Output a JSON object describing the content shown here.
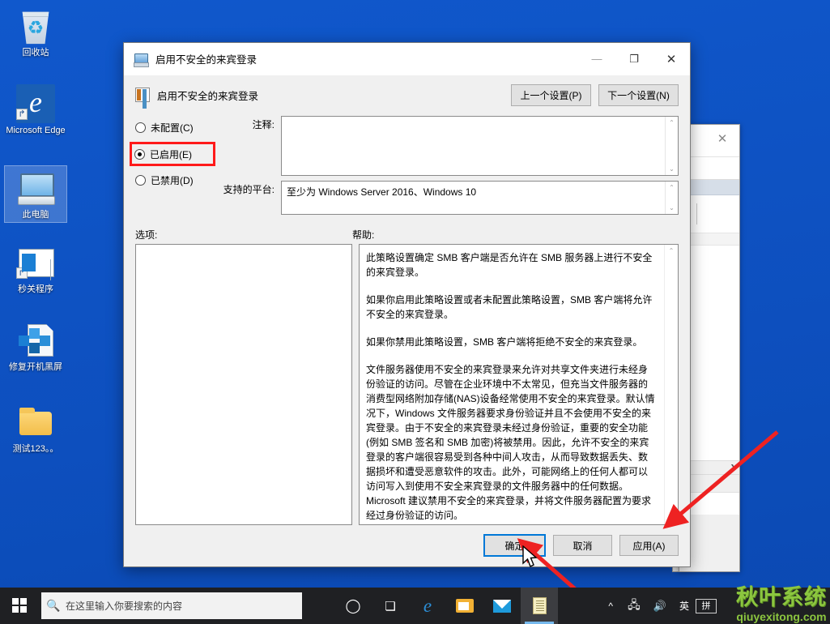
{
  "desktop": {
    "icons": [
      {
        "label": "回收站",
        "icon": "recycle-bin-icon",
        "selected": false,
        "shortcut": false
      },
      {
        "label": "Microsoft Edge",
        "icon": "microsoft-edge-icon",
        "selected": false,
        "shortcut": true
      },
      {
        "label": "此电脑",
        "icon": "this-pc-icon",
        "selected": true,
        "shortcut": false
      },
      {
        "label": "秒关程序",
        "icon": "program-window-icon",
        "selected": false,
        "shortcut": true
      },
      {
        "label": "修复开机黑屏",
        "icon": "file-cube-icon",
        "selected": false,
        "shortcut": false
      },
      {
        "label": "测试123。。",
        "icon": "folder-icon",
        "selected": false,
        "shortcut": false
      }
    ],
    "background_color": "#0f55c9"
  },
  "dialog": {
    "titlebar": {
      "icon": "policy-setting-icon",
      "title": "启用不安全的来宾登录",
      "minimize_label": "—",
      "maximize_label": "❐",
      "close_label": "✕"
    },
    "header": {
      "icon": "policy-list-icon",
      "title": "启用不安全的来宾登录",
      "prev_button": "上一个设置(P)",
      "next_button": "下一个设置(N)"
    },
    "radios": [
      {
        "label": "未配置(C)",
        "checked": false,
        "highlighted": false
      },
      {
        "label": "已启用(E)",
        "checked": true,
        "highlighted": true
      },
      {
        "label": "已禁用(D)",
        "checked": false,
        "highlighted": false
      }
    ],
    "comment": {
      "label": "注释:",
      "value": ""
    },
    "platform": {
      "label": "支持的平台:",
      "value": "至少为 Windows Server 2016、Windows 10"
    },
    "options": {
      "label": "选项:",
      "value": ""
    },
    "help": {
      "label": "帮助:",
      "paragraphs": [
        "此策略设置确定 SMB 客户端是否允许在 SMB 服务器上进行不安全的来宾登录。",
        "如果你启用此策略设置或者未配置此策略设置，SMB 客户端将允许不安全的来宾登录。",
        "如果你禁用此策略设置，SMB 客户端将拒绝不安全的来宾登录。",
        "文件服务器使用不安全的来宾登录来允许对共享文件夹进行未经身份验证的访问。尽管在企业环境中不太常见，但充当文件服务器的消费型网络附加存储(NAS)设备经常使用不安全的来宾登录。默认情况下，Windows 文件服务器要求身份验证并且不会使用不安全的来宾登录。由于不安全的来宾登录未经过身份验证，重要的安全功能(例如 SMB 签名和 SMB 加密)将被禁用。因此，允许不安全的来宾登录的客户端很容易受到各种中间人攻击，从而导致数据丢失、数据损坏和遭受恶意软件的攻击。此外，可能网络上的任何人都可以访问写入到使用不安全来宾登录的文件服务器中的任何数据。Microsoft 建议禁用不安全的来宾登录，并将文件服务器配置为要求经过身份验证的访问。"
      ]
    },
    "footer": {
      "ok": "确定",
      "cancel": "取消",
      "apply": "应用(A)"
    }
  },
  "taskbar": {
    "start_label": "start-button",
    "search_placeholder": "在这里输入你要搜索的内容",
    "apps": [
      {
        "name": "cortana-icon",
        "glyph": "◯",
        "active": false
      },
      {
        "name": "task-view-icon",
        "glyph": "❏",
        "active": false
      },
      {
        "name": "microsoft-edge-icon",
        "glyph": "e",
        "active": false
      },
      {
        "name": "file-explorer-icon",
        "glyph": "▤",
        "active": false
      },
      {
        "name": "mail-icon",
        "glyph": "✉",
        "active": false
      },
      {
        "name": "group-policy-editor-icon",
        "glyph": "▤",
        "active": true
      }
    ],
    "tray": [
      {
        "name": "show-hidden-icons",
        "glyph": "^"
      },
      {
        "name": "network-icon",
        "glyph": "🖧"
      },
      {
        "name": "volume-icon",
        "glyph": "🔊"
      },
      {
        "name": "ime-language-indicator",
        "glyph": "英"
      },
      {
        "name": "ime-pinyin-indicator",
        "glyph": "拼"
      }
    ]
  },
  "watermark": {
    "cn": "秋叶系统",
    "en": "qiuyexitong.com",
    "color": "#8cc63f"
  },
  "annotations": {
    "highlight_color": "#ff1a1a",
    "arrow_color": "#ee2222"
  }
}
